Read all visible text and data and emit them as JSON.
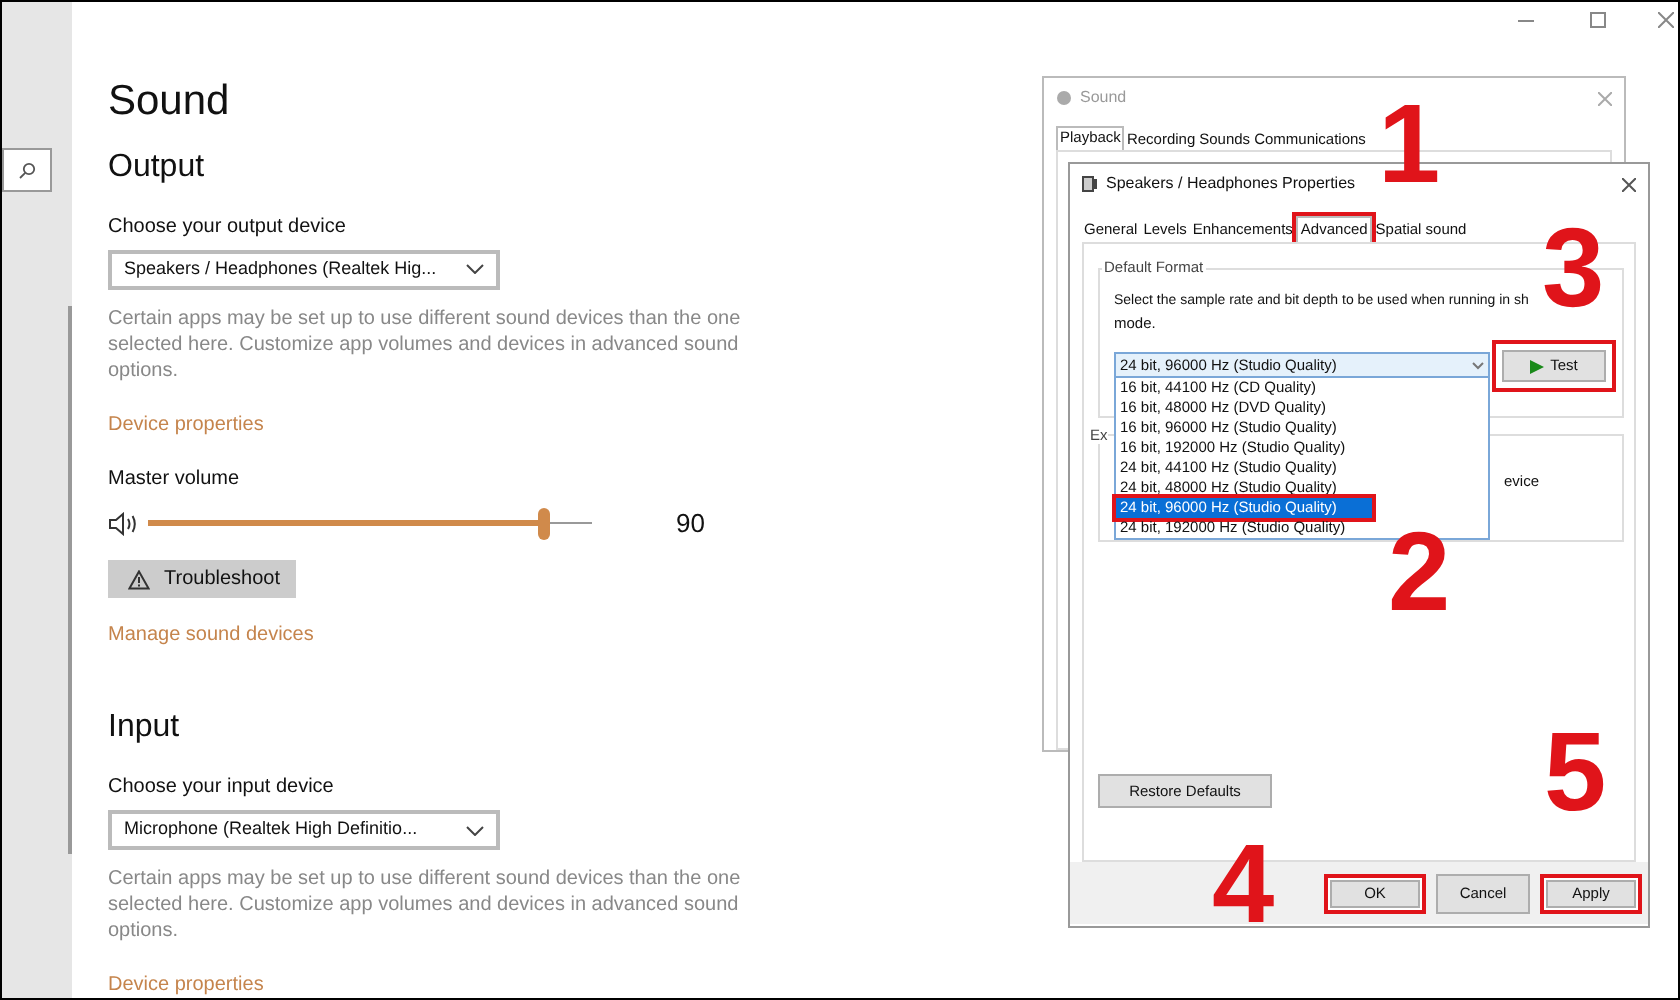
{
  "settings": {
    "title": "Sound",
    "output": {
      "heading": "Output",
      "device_label": "Choose your output device",
      "device": "Speakers / Headphones (Realtek Hig...",
      "note": "Certain apps may be set up to use different sound devices than the one selected here. Customize app volumes and devices in advanced sound options.",
      "link": "Device properties",
      "volume_label": "Master volume",
      "volume": {
        "level": 0.89,
        "reading": "90"
      },
      "troubleshoot": "Troubleshoot",
      "manage_link": "Manage sound devices"
    },
    "input": {
      "heading": "Input",
      "device_label": "Choose your input device",
      "device": "Microphone (Realtek High Definitio...",
      "note": "Certain apps may be set up to use different sound devices than the one selected here. Customize app volumes and devices in advanced sound options.",
      "link": "Device properties"
    }
  },
  "sound_dialog": {
    "title": "Sound",
    "tabs": [
      {
        "label": "Playback",
        "selected": true
      },
      {
        "label": "Recording",
        "selected": false
      },
      {
        "label": "Sounds",
        "selected": false
      },
      {
        "label": "Communications",
        "selected": false
      }
    ]
  },
  "properties_dialog": {
    "title": "Speakers / Headphones Properties",
    "tabs": [
      {
        "label": "General",
        "selected": false,
        "marked": false
      },
      {
        "label": "Levels",
        "selected": false,
        "marked": false
      },
      {
        "label": "Enhancements",
        "selected": false,
        "marked": false
      },
      {
        "label": "Advanced",
        "selected": true,
        "marked": true
      },
      {
        "label": "Spatial sound",
        "selected": false,
        "marked": false
      }
    ],
    "group_title": "Default Format",
    "description": [
      "Select the sample rate and bit depth to be used when running in sh",
      "mode."
    ],
    "format_select": "24 bit, 96000 Hz (Studio Quality)",
    "format_options": [
      {
        "label": "16 bit, 44100 Hz (CD Quality)",
        "selected": false,
        "marked": false
      },
      {
        "label": "16 bit, 48000 Hz (DVD Quality)",
        "selected": false,
        "marked": false
      },
      {
        "label": "16 bit, 96000 Hz (Studio Quality)",
        "selected": false,
        "marked": false
      },
      {
        "label": "16 bit, 192000 Hz (Studio Quality)",
        "selected": false,
        "marked": false
      },
      {
        "label": "24 bit, 44100 Hz (Studio Quality)",
        "selected": false,
        "marked": false
      },
      {
        "label": "24 bit, 48000 Hz (Studio Quality)",
        "selected": false,
        "marked": false
      },
      {
        "label": "24 bit, 96000 Hz (Studio Quality)",
        "selected": true,
        "marked": true
      },
      {
        "label": "24 bit, 192000 Hz (Studio Quality)",
        "selected": false,
        "marked": false
      }
    ],
    "test_button": {
      "label": "Test",
      "marked": true
    },
    "group_2": {
      "title_fragment": "Ex",
      "text_fragment": "evice"
    },
    "restore_button": "Restore Defaults",
    "buttons": [
      {
        "label": "OK",
        "marked": true
      },
      {
        "label": "Cancel",
        "marked": false
      },
      {
        "label": "Apply",
        "marked": true
      }
    ]
  },
  "annotations": [
    "1",
    "2",
    "3",
    "4",
    "5"
  ]
}
